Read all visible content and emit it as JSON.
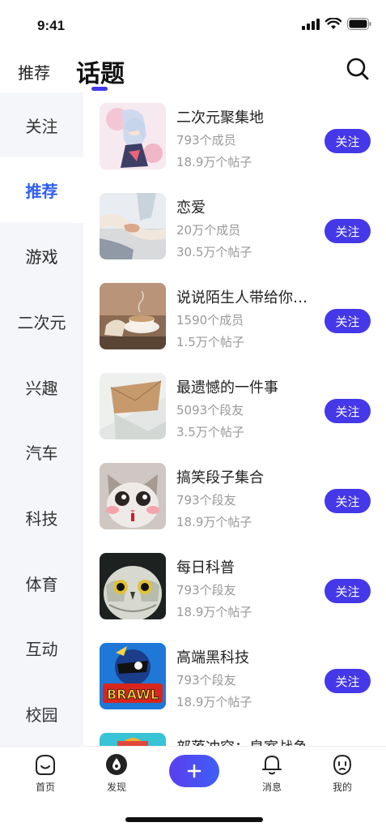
{
  "status": {
    "time": "9:41"
  },
  "header": {
    "tab_recommend": "推荐",
    "tab_topics": "话题"
  },
  "sidebar": {
    "items": [
      {
        "label": "关注"
      },
      {
        "label": "推荐"
      },
      {
        "label": "游戏"
      },
      {
        "label": "二次元"
      },
      {
        "label": "兴趣"
      },
      {
        "label": "汽车"
      },
      {
        "label": "科技"
      },
      {
        "label": "体育"
      },
      {
        "label": "互动"
      },
      {
        "label": "校园"
      }
    ]
  },
  "topics": [
    {
      "title": "二次元聚集地",
      "members": "793个成员",
      "posts": "18.9万个帖子",
      "follow": "关注"
    },
    {
      "title": "恋爱",
      "members": "20万个成员",
      "posts": "30.5万个帖子",
      "follow": "关注"
    },
    {
      "title": "说说陌生人带给你…",
      "members": "1590个成员",
      "posts": "1.5万个帖子",
      "follow": "关注"
    },
    {
      "title": "最遗憾的一件事",
      "members": "5093个段友",
      "posts": "3.5万个帖子",
      "follow": "关注"
    },
    {
      "title": "搞笑段子集合",
      "members": "793个段友",
      "posts": "18.9万个帖子",
      "follow": "关注"
    },
    {
      "title": "每日科普",
      "members": "793个段友",
      "posts": "18.9万个帖子",
      "follow": "关注"
    },
    {
      "title": "高端黑科技",
      "members": "793个段友",
      "posts": "18.9万个帖子",
      "follow": "关注"
    },
    {
      "title": "部落冲突：皇室战争",
      "members": "",
      "posts": "",
      "follow": ""
    }
  ],
  "tabbar": {
    "home": "首页",
    "discover": "发现",
    "messages": "消息",
    "mine": "我的"
  },
  "colors": {
    "accent": "#4438e8",
    "active_side": "#2f5ff0",
    "sidebar_bg": "#f5f6fa"
  }
}
